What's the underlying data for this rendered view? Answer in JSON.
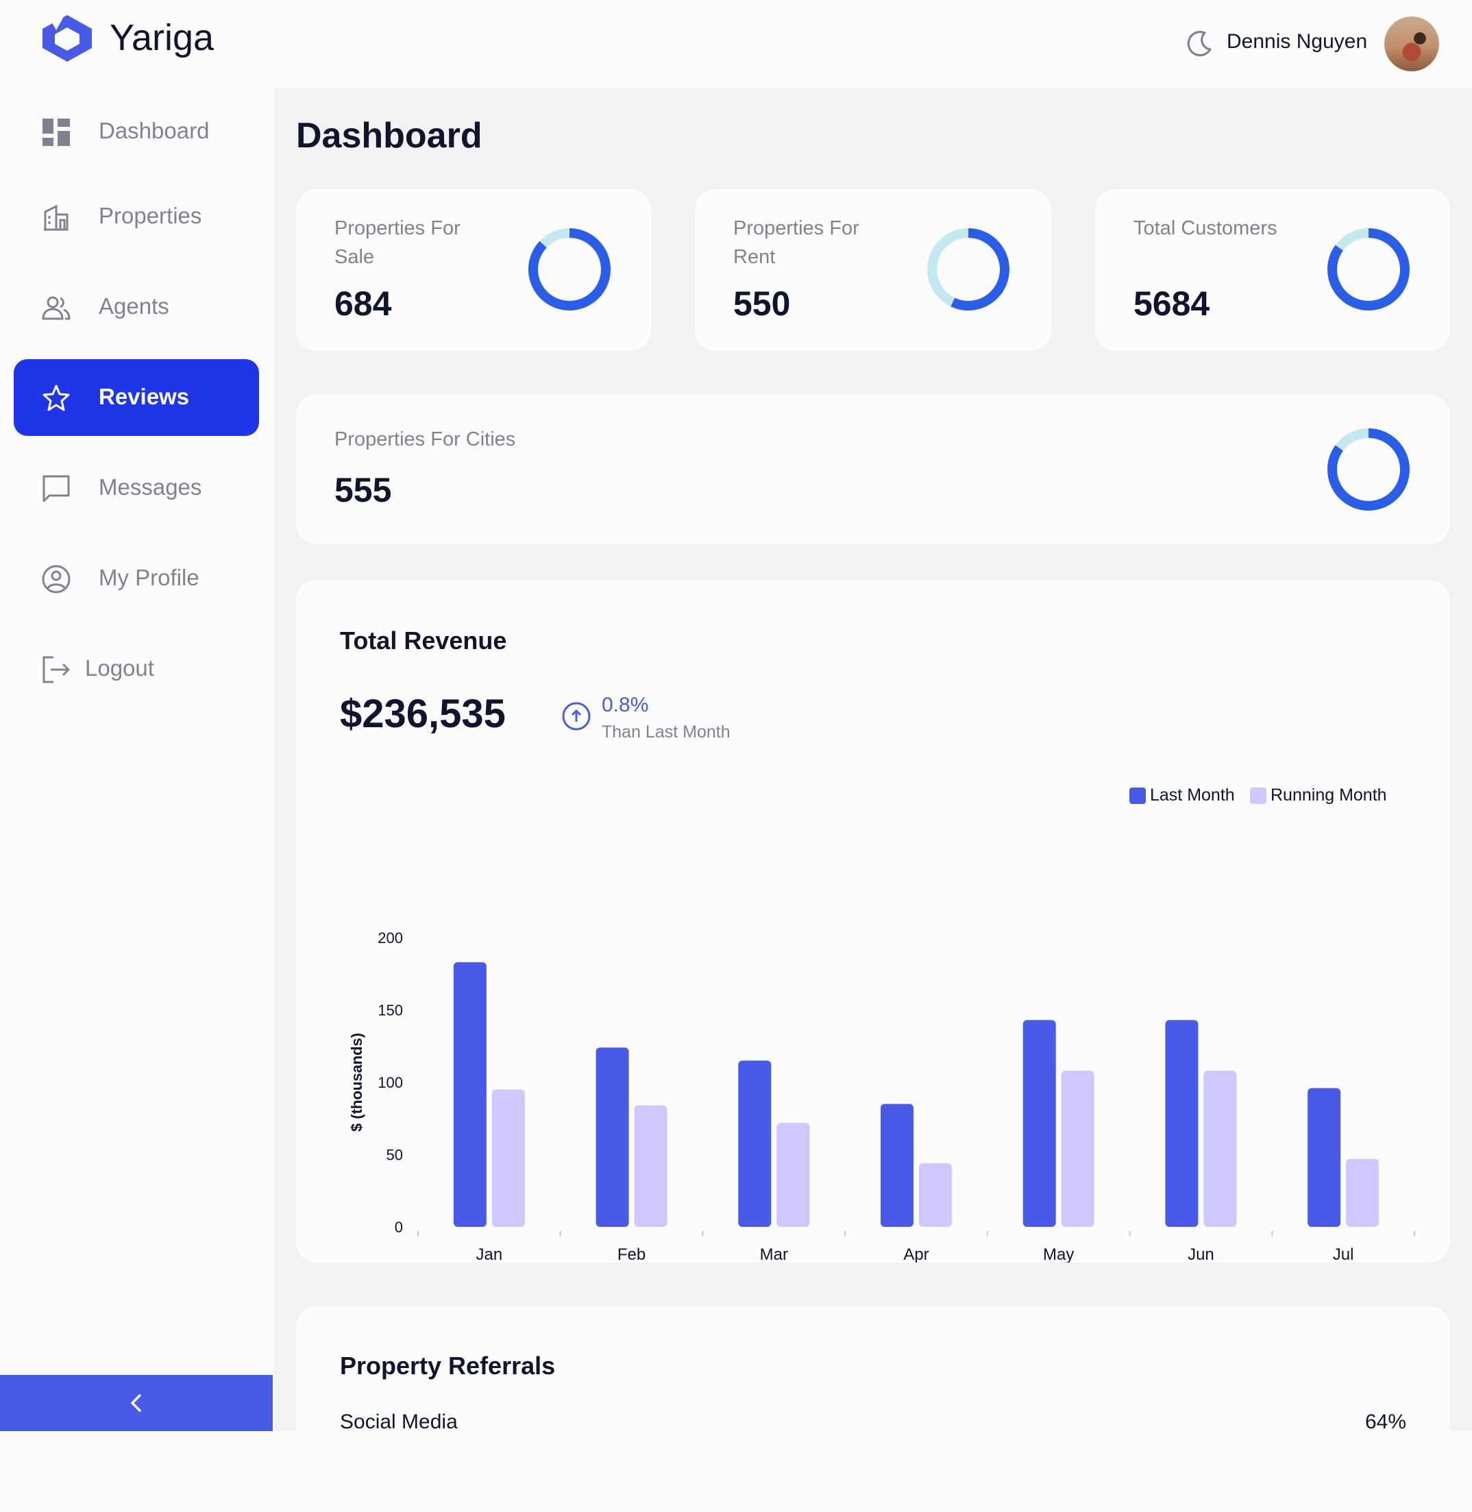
{
  "header": {
    "brand": "Yariga",
    "user_name": "Dennis Nguyen"
  },
  "sidebar": {
    "items": [
      {
        "label": "Dashboard",
        "icon": "dashboard-icon"
      },
      {
        "label": "Properties",
        "icon": "building-icon"
      },
      {
        "label": "Agents",
        "icon": "people-icon"
      },
      {
        "label": "Reviews",
        "icon": "star-icon",
        "active": true
      },
      {
        "label": "Messages",
        "icon": "chat-icon"
      },
      {
        "label": "My Profile",
        "icon": "user-circle-icon"
      },
      {
        "label": "Logout",
        "icon": "logout-icon"
      }
    ]
  },
  "main": {
    "title": "Dashboard",
    "stats": [
      {
        "title": "Properties For Sale",
        "value": "684",
        "progress": 0.87
      },
      {
        "title": "Properties For Rent",
        "value": "550",
        "progress": 0.57
      },
      {
        "title": "Total Customers",
        "value": "5684",
        "progress": 0.85
      },
      {
        "title": "Properties For Cities",
        "value": "555",
        "progress": 0.85
      }
    ],
    "revenue": {
      "title": "Total Revenue",
      "value": "$236,535",
      "trend_pct": "0.8%",
      "trend_label": "Than Last Month"
    },
    "referrals": {
      "title": "Property Referrals",
      "first_label": "Social Media",
      "first_pct": "64%"
    }
  },
  "colors": {
    "primary": "#475be8",
    "active_nav": "#1e36e8",
    "running_month": "#cfc8ff",
    "donut_fill": "#2b5ee8",
    "donut_track": "#c4e8ef"
  },
  "chart_data": {
    "type": "bar",
    "categories": [
      "Jan",
      "Feb",
      "Mar",
      "Apr",
      "May",
      "Jun",
      "Jul"
    ],
    "series": [
      {
        "name": "Last Month",
        "values": [
          183,
          124,
          115,
          85,
          143,
          143,
          96
        ]
      },
      {
        "name": "Running Month",
        "values": [
          95,
          84,
          72,
          44,
          108,
          108,
          47
        ]
      }
    ],
    "ylabel": "$ (thousands)",
    "yticks": [
      0,
      50,
      100,
      150,
      200
    ],
    "ylim": [
      0,
      200
    ],
    "legend": "top-right"
  }
}
